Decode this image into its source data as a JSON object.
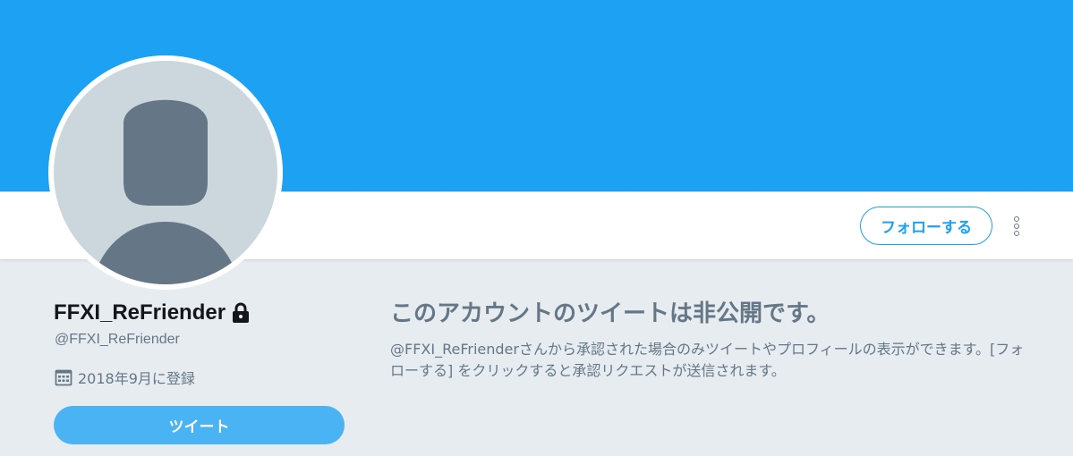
{
  "header": {
    "banner_color": "#1da1f2"
  },
  "nav": {
    "follow_label": "フォローする",
    "more_icon": "vertical-dots-icon"
  },
  "profile": {
    "name": "FFXI_ReFriender",
    "protected_icon": "lock-icon",
    "screen_name": "@FFXI_ReFriender",
    "join_icon": "calendar-icon",
    "join_date": "2018年9月に登録",
    "tweet_label": "ツイート",
    "avatar_icon": "default-avatar-icon"
  },
  "protected_notice": {
    "title": "このアカウントのツイートは非公開です。",
    "message": "@FFXI_ReFrienderさんから承認された場合のみツイートやプロフィールの表示ができます。[フォローする] をクリックすると承認リクエストが送信されます。"
  },
  "colors": {
    "accent": "#1da1f2",
    "tweet_button": "#4ab3f4",
    "muted_text": "#657786",
    "page_background": "#e6ecf0"
  }
}
